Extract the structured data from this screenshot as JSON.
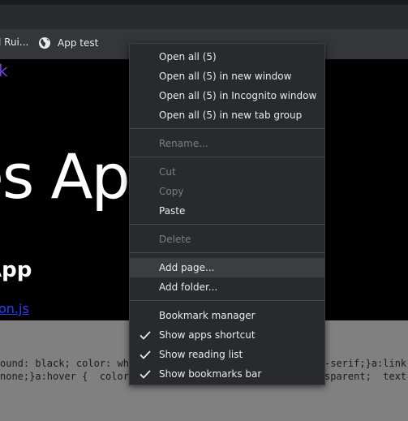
{
  "bookmarks_bar": {
    "items": [
      {
        "label": "l Rui..."
      },
      {
        "label": "App test",
        "icon": "globe-icon"
      }
    ]
  },
  "page": {
    "small_link": "k",
    "big_title": "es App",
    "subtitle": "App",
    "file_link": "on.js"
  },
  "source_view": {
    "line1_left": "ound: black; color: wh",
    "line1_right": "-serif;}a:link",
    "line2_left": "none;}a:hover {  color",
    "line2_right": "sparent;  text-"
  },
  "context_menu": {
    "open_all": "Open all (5)",
    "open_all_new_window": "Open all (5) in new window",
    "open_all_incognito": "Open all (5) in Incognito window",
    "open_all_tab_group": "Open all (5) in new tab group",
    "rename": "Rename...",
    "cut": "Cut",
    "copy": "Copy",
    "paste": "Paste",
    "delete": "Delete",
    "add_page": "Add page...",
    "add_folder": "Add folder...",
    "bookmark_manager": "Bookmark manager",
    "show_apps_shortcut": "Show apps shortcut",
    "show_reading_list": "Show reading list",
    "show_bookmarks_bar": "Show bookmarks bar"
  }
}
